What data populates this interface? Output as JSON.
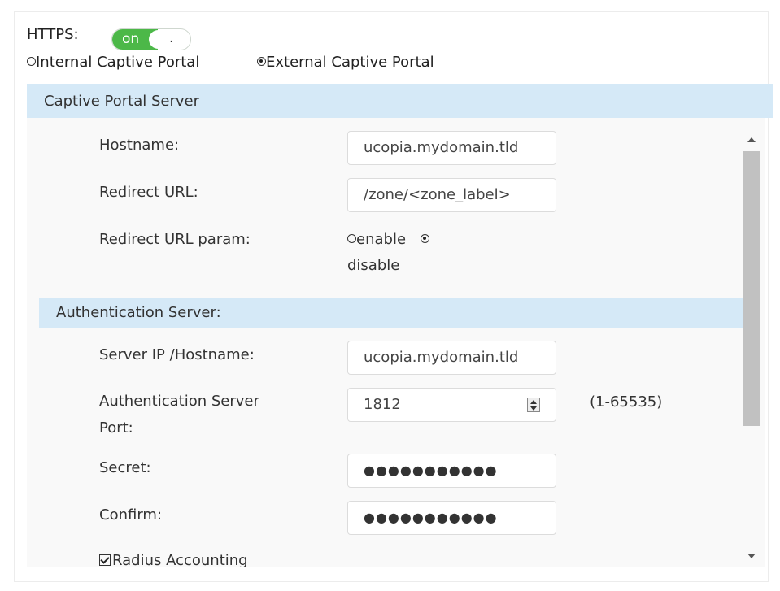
{
  "https": {
    "label": "HTTPS:",
    "toggle_on": "on",
    "toggle_off": "."
  },
  "portal": {
    "internal_label": "Internal Captive Portal",
    "external_label": "External Captive Portal",
    "selected": "external"
  },
  "captive_portal_server": {
    "title": "Captive Portal Server",
    "hostname_label": "Hostname:",
    "hostname_value": "ucopia.mydomain.tld",
    "redirect_url_label": "Redirect URL:",
    "redirect_url_value": "/zone/<zone_label>",
    "redirect_param_label": "Redirect URL param:",
    "enable_label": "enable",
    "disable_label": "disable",
    "redirect_param_selected": "disable"
  },
  "authentication_server": {
    "title": "Authentication Server:",
    "server_label": "Server IP /Hostname:",
    "server_value": "ucopia.mydomain.tld",
    "port_label_line1": "Authentication Server",
    "port_label_line2": "Port:",
    "port_value": "1812",
    "port_range": "(1-65535)",
    "secret_label": "Secret:",
    "secret_value": "●●●●●●●●●●●",
    "confirm_label": "Confirm:",
    "confirm_value": "●●●●●●●●●●●",
    "radius_accounting_label": "Radius Accounting",
    "radius_accounting_checked": true
  },
  "colors": {
    "toggle_green": "#4cb848",
    "section_header_bg": "#d5e9f7"
  }
}
